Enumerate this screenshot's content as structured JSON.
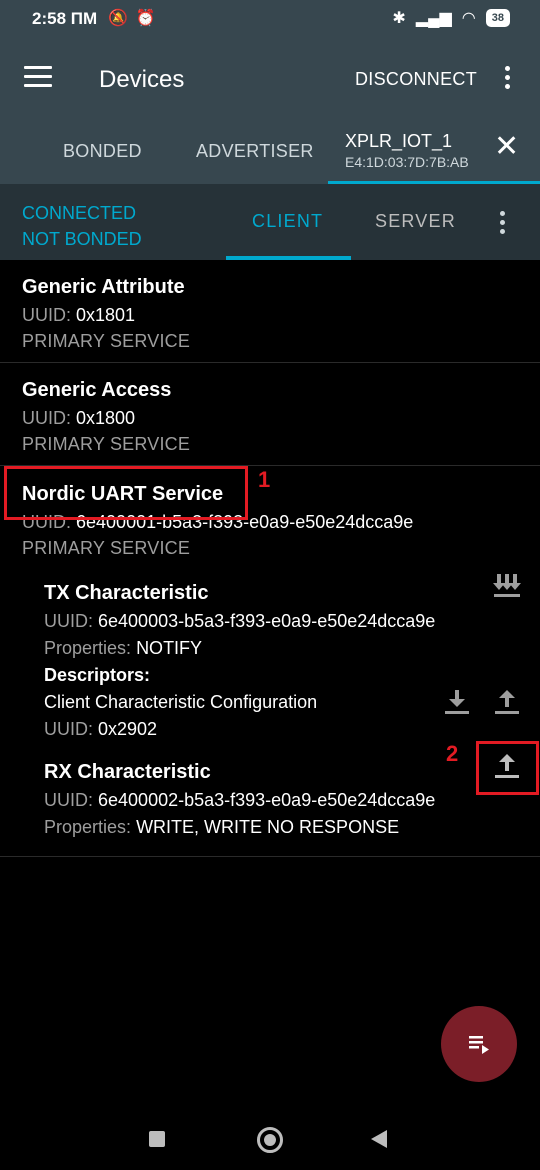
{
  "status_bar": {
    "time": "2:58 ПМ",
    "battery": "38"
  },
  "app_bar": {
    "title": "Devices",
    "disconnect_label": "DISCONNECT"
  },
  "tabs": {
    "bonded": "BONDED",
    "advertiser": "ADVERTISER",
    "device_name": "XPLR_IOT_1",
    "device_address": "E4:1D:03:7D:7B:AB"
  },
  "connection": {
    "state": "CONNECTED",
    "bond_state": "NOT BONDED",
    "client_tab": "CLIENT",
    "server_tab": "SERVER"
  },
  "uuid_label": "UUID:",
  "properties_label": "Properties:",
  "services": [
    {
      "name": "Generic Attribute",
      "uuid": "0x1801",
      "type": "PRIMARY SERVICE"
    },
    {
      "name": "Generic Access",
      "uuid": "0x1800",
      "type": "PRIMARY SERVICE"
    },
    {
      "name": "Nordic UART Service",
      "uuid": "6e400001-b5a3-f393-e0a9-e50e24dcca9e",
      "type": "PRIMARY SERVICE"
    }
  ],
  "characteristics": {
    "tx": {
      "name": "TX Characteristic",
      "uuid": "6e400003-b5a3-f393-e0a9-e50e24dcca9e",
      "properties": "NOTIFY",
      "descriptors_label": "Descriptors:",
      "descriptor_name": "Client Characteristic Configuration",
      "descriptor_uuid": "0x2902"
    },
    "rx": {
      "name": "RX Characteristic",
      "uuid": "6e400002-b5a3-f393-e0a9-e50e24dcca9e",
      "properties": "WRITE, WRITE NO RESPONSE"
    }
  },
  "annotations": {
    "marker_1": "1",
    "marker_2": "2"
  },
  "colors": {
    "accent": "#00a9ce",
    "toolbar": "#37474f",
    "subbar": "#263238",
    "highlight": "#e31b23",
    "fab": "#7b1e28"
  },
  "icons": [
    "menu-icon",
    "overflow-icon",
    "close-icon",
    "notify-icon",
    "download-icon",
    "upload-icon",
    "log-icon"
  ]
}
